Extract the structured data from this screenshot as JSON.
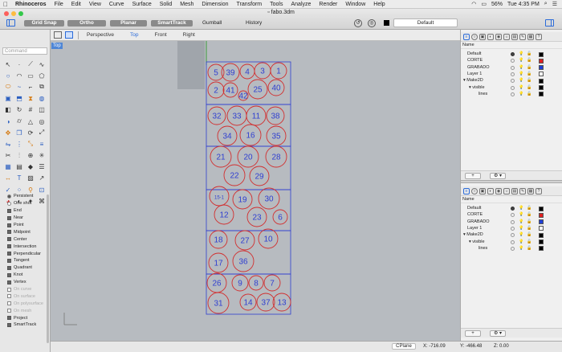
{
  "menubar": {
    "app": "Rhinoceros",
    "items": [
      "File",
      "Edit",
      "View",
      "Curve",
      "Surface",
      "Solid",
      "Mesh",
      "Dimension",
      "Transform",
      "Tools",
      "Analyze",
      "Render",
      "Window",
      "Help"
    ],
    "battery": "56%",
    "clock": "Tue 4:35 PM"
  },
  "window": {
    "title": "fabo.3dm"
  },
  "toolbar": {
    "grid_snap": "Grid Snap",
    "ortho": "Ortho",
    "planar": "Planar",
    "smarttrack": "SmartTrack",
    "gumball": "Gumball",
    "history": "History",
    "current_layer": "Default",
    "layer_color": "#000000"
  },
  "viewport_tabs": [
    "Perspective",
    "Top",
    "Front",
    "Right"
  ],
  "active_viewport": "Top",
  "viewport_label": "Top",
  "command": {
    "placeholder": "Command"
  },
  "tools": [
    "select-arrow-icon",
    "point-icon",
    "polyline-icon",
    "curve-icon",
    "circle-icon",
    "arc-icon",
    "rectangle-icon",
    "polygon-icon",
    "ellipse-icon",
    "free-curve-icon",
    "fillet-icon",
    "offset-icon",
    "box-icon",
    "extrude-icon",
    "loft-icon",
    "sphere-icon",
    "surface-icon",
    "revolve-icon",
    "network-icon",
    "patch-icon",
    "boolean-icon",
    "cylinder-icon",
    "cone-icon",
    "torus-icon",
    "move-icon",
    "copy-icon",
    "rotate-icon",
    "scale-icon",
    "mirror-icon",
    "array-icon",
    "orient-icon",
    "align-icon",
    "trim-icon",
    "split-icon",
    "join-icon",
    "explode-icon",
    "group-icon",
    "ungroup-icon",
    "block-icon",
    "layer-icon",
    "dimension-icon",
    "text-icon",
    "hatch-icon",
    "leader-icon",
    "check-icon",
    "edit-points-icon",
    "zoom-icon",
    "zoom-window-icon",
    "render-icon",
    "material-icon",
    "light-icon",
    "camera-icon"
  ],
  "osnap": {
    "persistent": "Persistent",
    "one_shot": "One shot",
    "items": [
      {
        "label": "End",
        "checked": true
      },
      {
        "label": "Near",
        "checked": true
      },
      {
        "label": "Point",
        "checked": true
      },
      {
        "label": "Midpoint",
        "checked": true
      },
      {
        "label": "Center",
        "checked": true
      },
      {
        "label": "Intersection",
        "checked": true
      },
      {
        "label": "Perpendicular",
        "checked": true
      },
      {
        "label": "Tangent",
        "checked": true
      },
      {
        "label": "Quadrant",
        "checked": true
      },
      {
        "label": "Knot",
        "checked": true
      },
      {
        "label": "Vertex",
        "checked": true
      },
      {
        "label": "On curve",
        "checked": false
      },
      {
        "label": "On surface",
        "checked": false
      },
      {
        "label": "On polysurface",
        "checked": false
      },
      {
        "label": "On mesh",
        "checked": false
      },
      {
        "label": "Project",
        "checked": true
      },
      {
        "label": "SmartTrack",
        "checked": true
      }
    ]
  },
  "layers_panel": {
    "header": "Name",
    "rows": [
      {
        "name": "Default",
        "indent": 0,
        "current": true,
        "color": "#000000"
      },
      {
        "name": "CORTE",
        "indent": 0,
        "current": false,
        "color": "#e02020"
      },
      {
        "name": "GRABADO",
        "indent": 0,
        "current": false,
        "color": "#1f3fd6"
      },
      {
        "name": "Layer 1",
        "indent": 0,
        "current": false,
        "color": "#ffffff"
      },
      {
        "name": "▾ Make2D",
        "indent": 0,
        "current": false,
        "color": "#000000"
      },
      {
        "name": "▾ visible",
        "indent": 1,
        "current": false,
        "color": "#000000"
      },
      {
        "name": "lines",
        "indent": 2,
        "current": false,
        "color": "#000000"
      }
    ],
    "add_button": "+",
    "gear_button": "⚙ ▾"
  },
  "status": {
    "cplane": "CPlane",
    "x": "X: -716.09",
    "y": "Y: -466.48",
    "z": "Z: 0.00"
  },
  "pieces": [
    [
      "5",
      "39",
      "4",
      "3",
      "1",
      "2",
      "41",
      "42",
      "25",
      "40"
    ],
    [
      "32",
      "33",
      "11",
      "38",
      "34",
      "16",
      "35"
    ],
    [
      "21",
      "20",
      "28",
      "22",
      "29"
    ],
    [
      "15-1",
      "19",
      "30",
      "12",
      "23",
      "6"
    ],
    [
      "18",
      "27",
      "10",
      "17",
      "36"
    ],
    [
      "26",
      "9",
      "8",
      "7",
      "31",
      "14",
      "37",
      "13"
    ]
  ]
}
